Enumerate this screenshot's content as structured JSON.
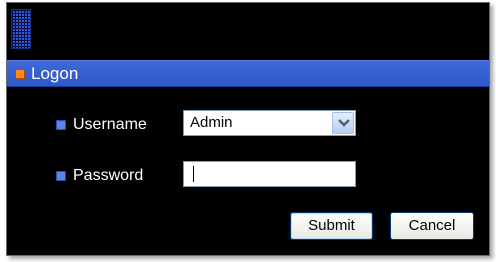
{
  "dialog": {
    "title": "Logon",
    "username": {
      "label": "Username",
      "selected_value": "Admin"
    },
    "password": {
      "label": "Password",
      "value": ""
    },
    "buttons": {
      "submit_label": "Submit",
      "cancel_label": "Cancel"
    }
  },
  "colors": {
    "background": "#000000",
    "title_bar": "#3562d0",
    "title_bullet": "#ff8a1a",
    "row_bullet": "#5e82e6"
  },
  "icons": {
    "header_logo": "grid-pattern-icon",
    "dropdown": "chevron-down-icon"
  }
}
